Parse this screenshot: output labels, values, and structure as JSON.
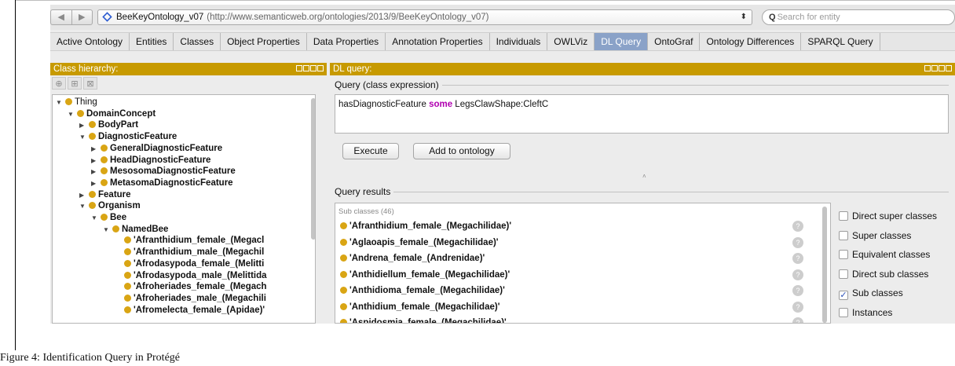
{
  "browser": {
    "url_name": "BeeKeyOntology_v07",
    "url_path": "(http://www.semanticweb.org/ontologies/2013/9/BeeKeyOntology_v07)",
    "search_placeholder": "Search for entity",
    "nav_back": "◀",
    "nav_forward": "▶",
    "stepper": "⬍"
  },
  "tabs": [
    {
      "label": "Active Ontology"
    },
    {
      "label": "Entities"
    },
    {
      "label": "Classes"
    },
    {
      "label": "Object Properties"
    },
    {
      "label": "Data Properties"
    },
    {
      "label": "Annotation Properties"
    },
    {
      "label": "Individuals"
    },
    {
      "label": "OWLViz"
    },
    {
      "label": "DL Query",
      "active": true
    },
    {
      "label": "OntoGraf"
    },
    {
      "label": "Ontology Differences"
    },
    {
      "label": "SPARQL Query"
    }
  ],
  "left_panel": {
    "title": "Class hierarchy:",
    "tree": [
      {
        "label": "Thing",
        "depth": 0,
        "expanded": true,
        "bold": false
      },
      {
        "label": "DomainConcept",
        "depth": 1,
        "expanded": true,
        "bold": true
      },
      {
        "label": "BodyPart",
        "depth": 2,
        "expanded": false,
        "bold": true
      },
      {
        "label": "DiagnosticFeature",
        "depth": 2,
        "expanded": true,
        "bold": true
      },
      {
        "label": "GeneralDiagnosticFeature",
        "depth": 3,
        "expanded": false,
        "bold": true
      },
      {
        "label": "HeadDiagnosticFeature",
        "depth": 3,
        "expanded": false,
        "bold": true
      },
      {
        "label": "MesosomaDiagnosticFeature",
        "depth": 3,
        "expanded": false,
        "bold": true
      },
      {
        "label": "MetasomaDiagnosticFeature",
        "depth": 3,
        "expanded": false,
        "bold": true
      },
      {
        "label": "Feature",
        "depth": 2,
        "expanded": false,
        "bold": true
      },
      {
        "label": "Organism",
        "depth": 2,
        "expanded": true,
        "bold": true
      },
      {
        "label": "Bee",
        "depth": 3,
        "expanded": true,
        "bold": true
      },
      {
        "label": "NamedBee",
        "depth": 4,
        "expanded": true,
        "bold": true
      },
      {
        "label": "'Afranthidium_female_(Megacl",
        "depth": 5,
        "leaf": true,
        "bold": true
      },
      {
        "label": "'Afranthidium_male_(Megachil",
        "depth": 5,
        "leaf": true,
        "bold": true
      },
      {
        "label": "'Afrodasypoda_female_(Melitti",
        "depth": 5,
        "leaf": true,
        "bold": true
      },
      {
        "label": "'Afrodasypoda_male_(Melittida",
        "depth": 5,
        "leaf": true,
        "bold": true
      },
      {
        "label": "'Afroheriades_female_(Megach",
        "depth": 5,
        "leaf": true,
        "bold": true
      },
      {
        "label": "'Afroheriades_male_(Megachili",
        "depth": 5,
        "leaf": true,
        "bold": true
      },
      {
        "label": "'Afromelecta_female_(Apidae)'",
        "depth": 5,
        "leaf": true,
        "bold": true
      }
    ]
  },
  "right_panel": {
    "title": "DL query:",
    "query_section": "Query (class expression)",
    "query": {
      "pre": "hasDiagnosticFeature ",
      "keyword": "some",
      "post": " LegsClawShape:CleftC"
    },
    "execute_label": "Execute",
    "add_label": "Add to ontology",
    "splitter": "˄",
    "results_section": "Query results",
    "results_sub": "Sub classes (46)",
    "results": [
      "'Afranthidium_female_(Megachilidae)'",
      "'Aglaoapis_female_(Megachilidae)'",
      "'Andrena_female_(Andrenidae)'",
      "'Anthidiellum_female_(Megachilidae)'",
      "'Anthidioma_female_(Megachilidae)'",
      "'Anthidium_female_(Megachilidae)'",
      "'Aspidosmia_female_(Megachilidae)'"
    ],
    "help_glyph": "?",
    "options": [
      {
        "label": "Direct super classes",
        "checked": false
      },
      {
        "label": "Super classes",
        "checked": false
      },
      {
        "label": "Equivalent classes",
        "checked": false
      },
      {
        "label": "Direct sub classes",
        "checked": false
      },
      {
        "label": "Sub classes",
        "checked": true
      },
      {
        "label": "Instances",
        "checked": false
      }
    ]
  },
  "caption": "Figure 4: Identification Query in  Protégé"
}
